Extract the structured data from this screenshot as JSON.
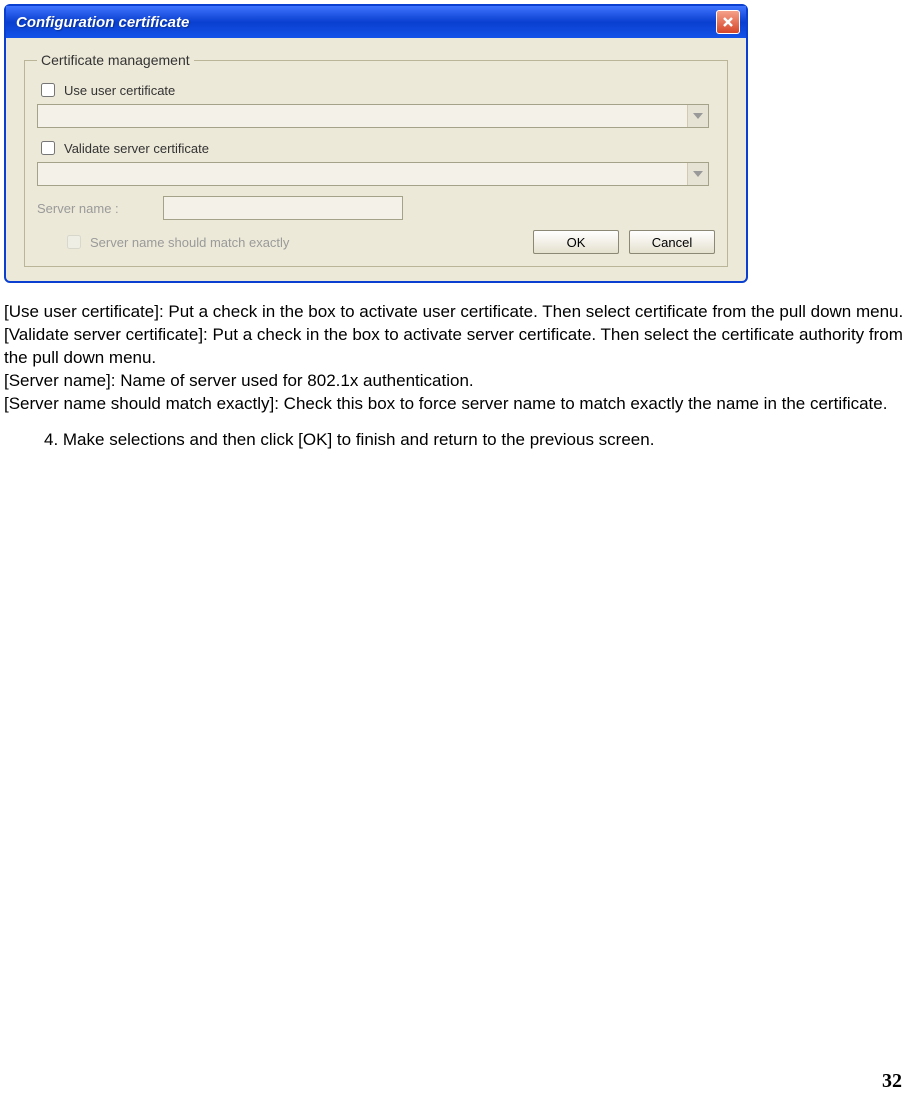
{
  "dialog": {
    "title": "Configuration certificate",
    "group_legend": "Certificate management",
    "use_user_cert_label": "Use user certificate",
    "user_cert_value": "",
    "validate_server_cert_label": "Validate server certificate",
    "server_cert_value": "",
    "server_name_label": "Server name :",
    "server_name_value": "",
    "match_exactly_label": "Server name should match exactly",
    "ok_label": "OK",
    "cancel_label": "Cancel"
  },
  "doc": {
    "p1": "[Use user certificate]: Put a check in the box to activate user certificate. Then select certificate from the pull down menu.",
    "p2": "[Validate server certificate]: Put a check in the box to activate server certificate. Then select the certificate authority from the pull down menu.",
    "p3": "[Server name]: Name of server used for 802.1x authentication.",
    "p4": "[Server name should match exactly]: Check this box to force server name to match exactly the name in the certificate.",
    "step4": "4. Make selections and then click [OK] to finish and return to the previous screen."
  },
  "page_number": "32"
}
